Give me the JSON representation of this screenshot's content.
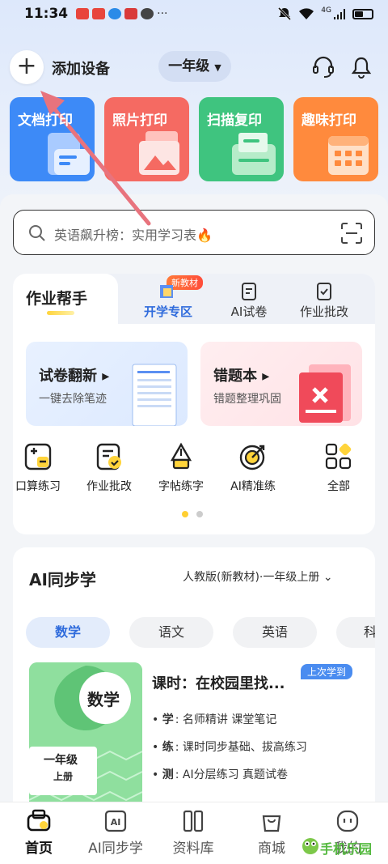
{
  "status_bar": {
    "time": "11:34",
    "network": "4G"
  },
  "header": {
    "add_device_label": "添加设备",
    "grade_label": "一年级"
  },
  "print_cards": [
    {
      "label": "文档打印",
      "color": "#3d8af7"
    },
    {
      "label": "照片打印",
      "color": "#f56a62"
    },
    {
      "label": "扫描复印",
      "color": "#3fc47f"
    },
    {
      "label": "趣味打印",
      "color": "#ff8a3d"
    }
  ],
  "search": {
    "placeholder": "英语飙升榜：实用学习表🔥"
  },
  "homework": {
    "title": "作业帮手",
    "new_badge": "新教材",
    "tabs": [
      "开学专区",
      "AI试卷",
      "作业批改"
    ],
    "features": [
      {
        "title": "试卷翻新",
        "subtitle": "一键去除笔迹"
      },
      {
        "title": "错题本",
        "subtitle": "错题整理巩固"
      }
    ],
    "grid": [
      {
        "label": "口算练习",
        "icon": "calculator-icon"
      },
      {
        "label": "作业批改",
        "icon": "check-doc-icon"
      },
      {
        "label": "字帖练字",
        "icon": "pen-nib-icon"
      },
      {
        "label": "AI精准练",
        "icon": "target-icon"
      },
      {
        "label": "全部",
        "icon": "grid-icon"
      }
    ]
  },
  "ai_sync": {
    "title": "AI同步学",
    "textbook": "人教版(新教材)·一年级上册",
    "subjects": [
      "数学",
      "语文",
      "英语",
      "科"
    ],
    "cover": {
      "subject": "数学",
      "grade": "一年级",
      "volume": "上册"
    },
    "last_badge": "上次学到",
    "lesson_title": "课时：在校园里找...",
    "items": [
      {
        "key": "学",
        "text": "名师精讲 课堂笔记"
      },
      {
        "key": "练",
        "text": "课时同步基础、拔高练习"
      },
      {
        "key": "测",
        "text": "AI分层练习 真题试卷"
      }
    ]
  },
  "bottom_nav": [
    "首页",
    "AI同步学",
    "资料库",
    "商城",
    "我的"
  ],
  "watermark": "手机乐园",
  "colors": {
    "accent": "#2f6bdc",
    "annotation_arrow": "#e8737d"
  }
}
